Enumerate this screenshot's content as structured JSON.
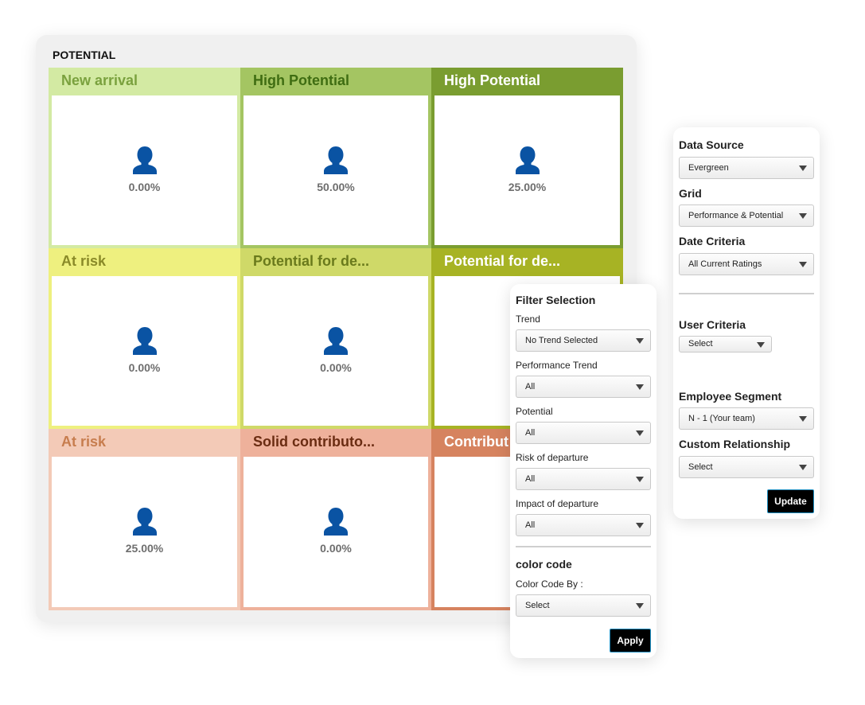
{
  "grid": {
    "title": "POTENTIAL",
    "cells": [
      {
        "label": "New arrival",
        "value": "0.00%",
        "bg": "#d3eaa3",
        "frame": "#d3eaa3",
        "label_color": "#7aa13e"
      },
      {
        "label": "High Potential",
        "value": "50.00%",
        "bg": "#a4c562",
        "frame": "#a4c562",
        "label_color": "#3f6d12"
      },
      {
        "label": "High Potential",
        "value": "25.00%",
        "bg": "#7a9d30",
        "frame": "#7a9d30",
        "label_color": "#ffffff"
      },
      {
        "label": "At risk",
        "value": "0.00%",
        "bg": "#eef07f",
        "frame": "#eef07f",
        "label_color": "#8a8a28"
      },
      {
        "label": "Potential for de...",
        "value": "0.00%",
        "bg": "#cfd968",
        "frame": "#cfd968",
        "label_color": "#6a7a1c"
      },
      {
        "label": "Potential for de...",
        "value": "",
        "bg": "#a7b324",
        "frame": "#a7b324",
        "label_color": "#ffffff"
      },
      {
        "label": "At risk",
        "value": "25.00%",
        "bg": "#f3cab7",
        "frame": "#f3cab7",
        "label_color": "#c77d4e"
      },
      {
        "label": "Solid contributo...",
        "value": "0.00%",
        "bg": "#eeb19b",
        "frame": "#eeb19b",
        "label_color": "#6a2c12"
      },
      {
        "label": "Contribut",
        "value": "",
        "bg": "#d6835f",
        "frame": "#d6835f",
        "label_color": "#ffffff"
      }
    ],
    "person_icon": "person-icon",
    "icon_color": "#0a53a3"
  },
  "filter_panel": {
    "title": "Filter Selection",
    "trend_label": "Trend",
    "trend_value": "No Trend Selected",
    "perf_trend_label": "Performance Trend",
    "perf_trend_value": "All",
    "potential_label": "Potential",
    "potential_value": "All",
    "risk_label": "Risk of departure",
    "risk_value": "All",
    "impact_label": "Impact of departure",
    "impact_value": "All",
    "color_code_title": "color code",
    "color_code_by_label": "Color Code By :",
    "color_code_by_value": "Select",
    "apply_label": "Apply"
  },
  "source_panel": {
    "data_source_label": "Data Source",
    "data_source_value": "Evergreen",
    "grid_label": "Grid",
    "grid_value": "Performance & Potential",
    "date_criteria_label": "Date Criteria",
    "date_criteria_value": "All Current Ratings",
    "user_criteria_label": "User Criteria",
    "user_criteria_value": "Select",
    "employee_segment_label": "Employee Segment",
    "employee_segment_value": "N - 1 (Your team)",
    "custom_relationship_label": "Custom Relationship",
    "custom_relationship_value": "Select",
    "update_label": "Update"
  }
}
